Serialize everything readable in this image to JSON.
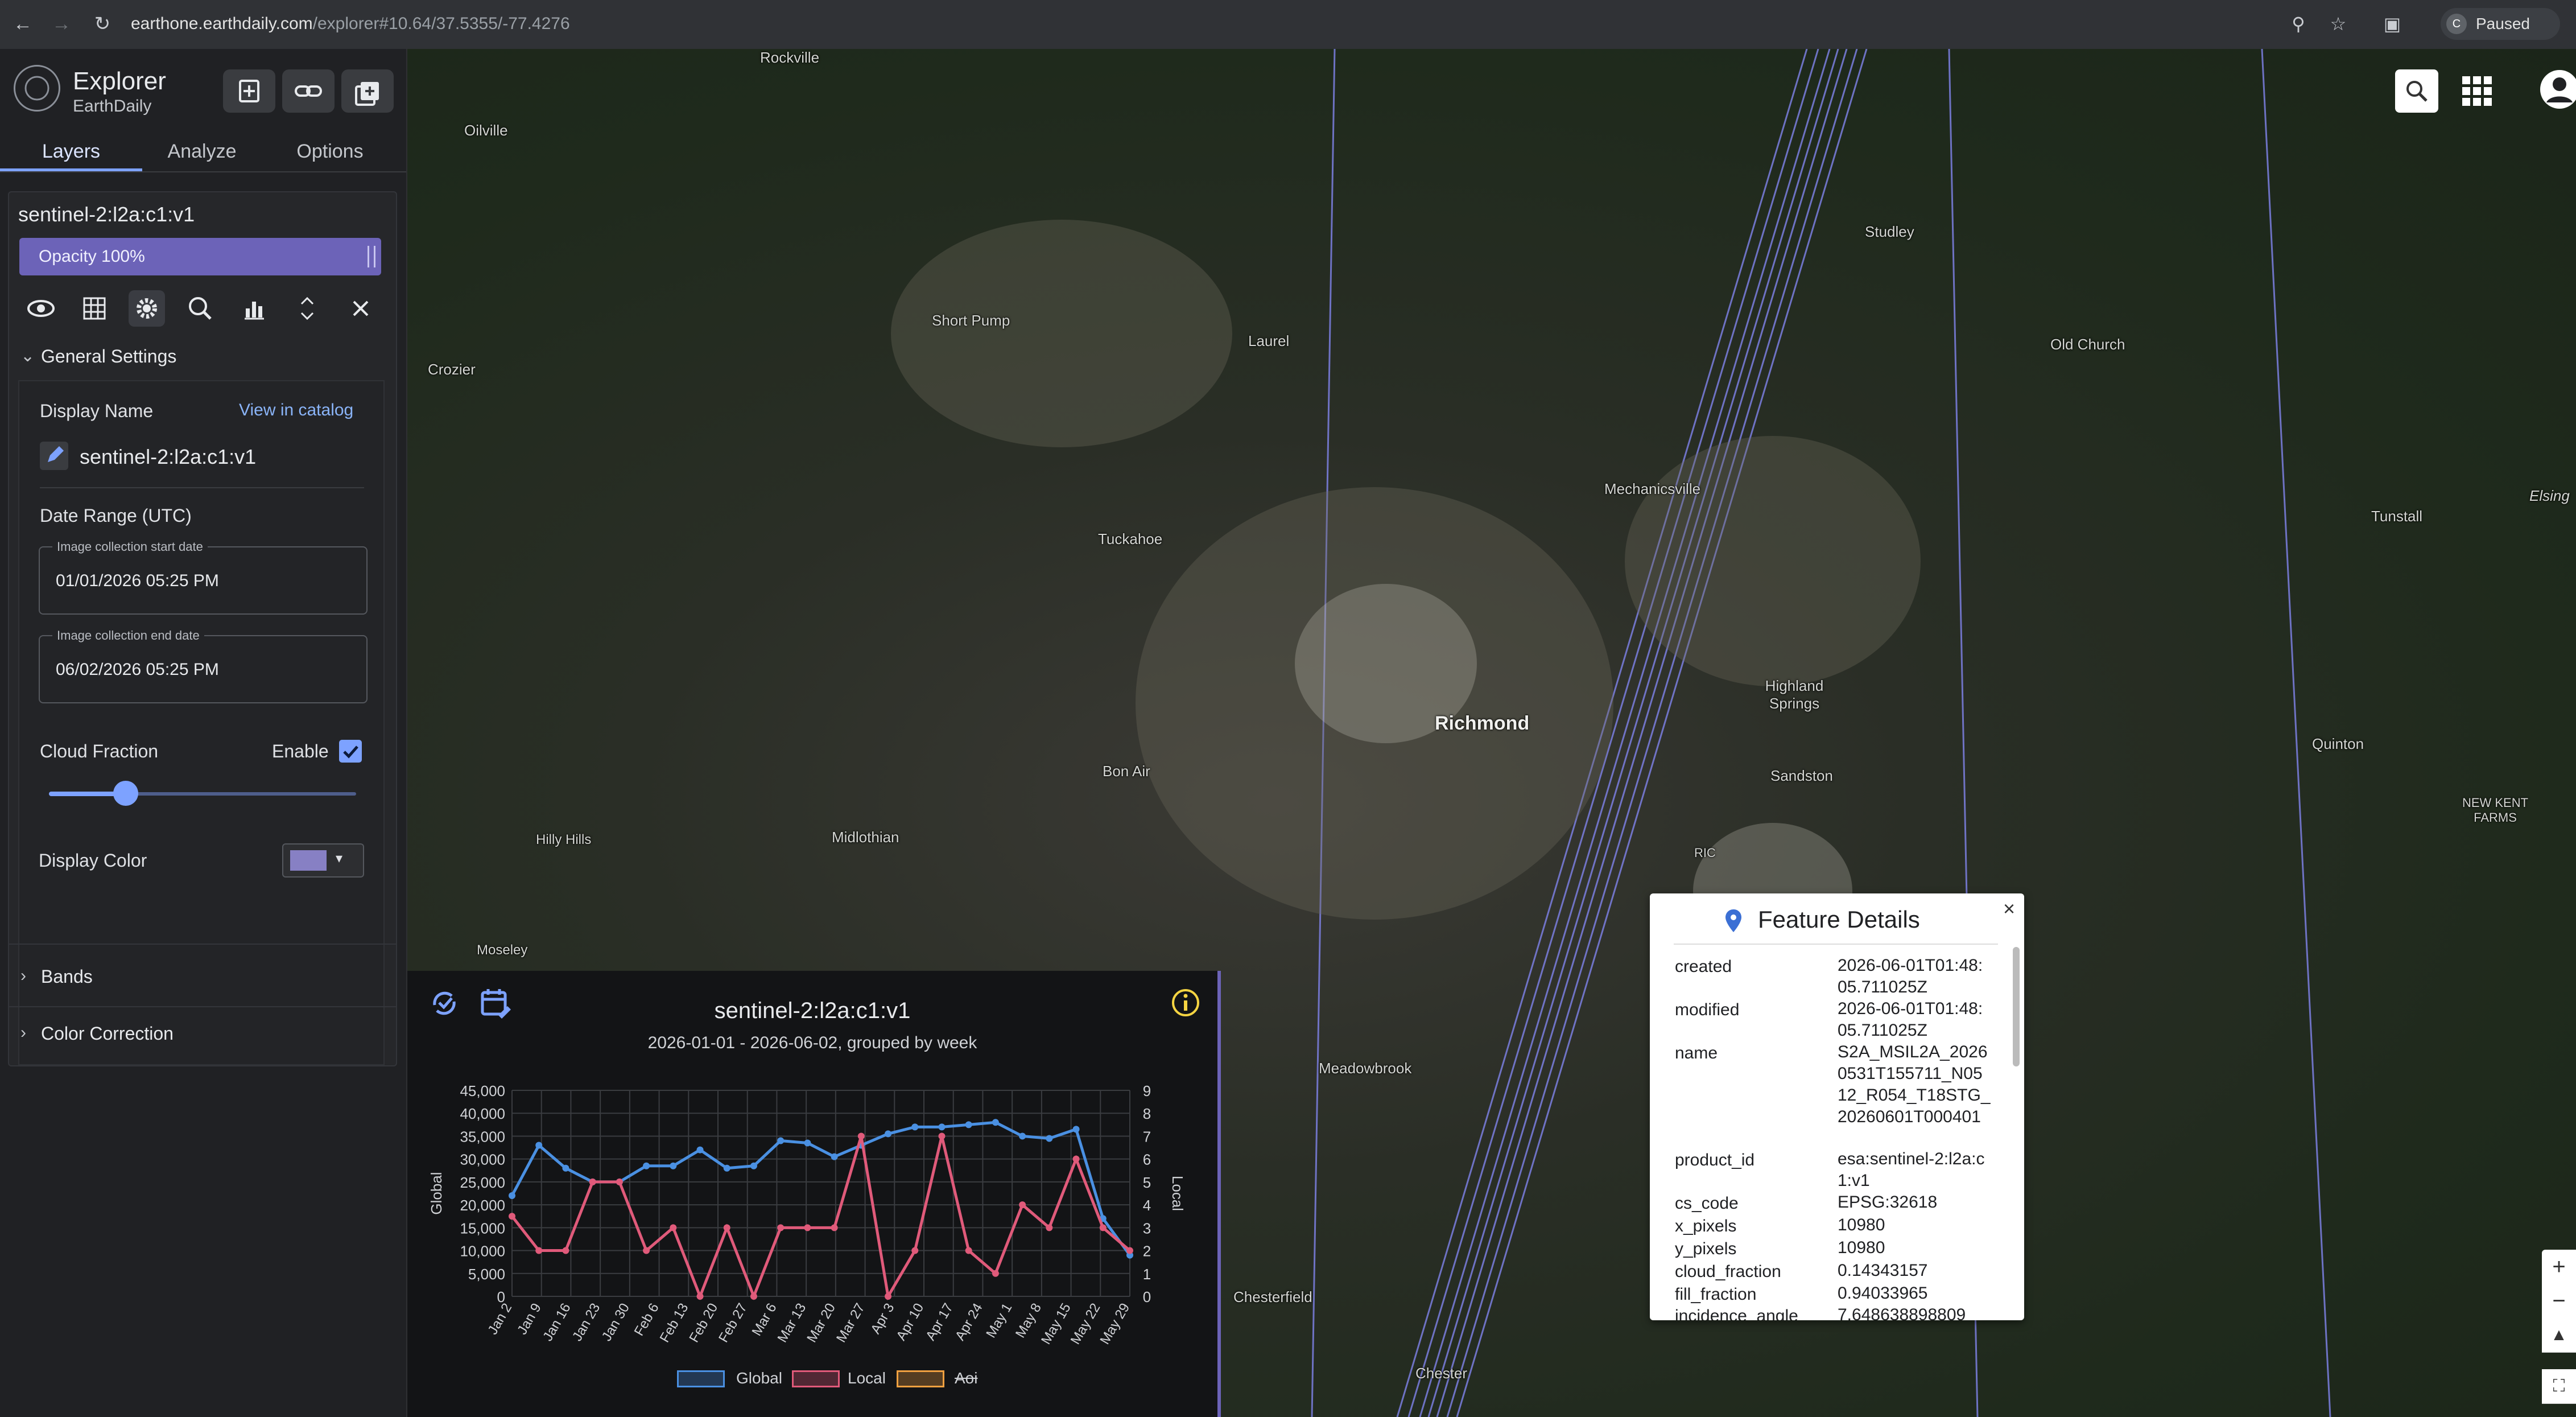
{
  "browser": {
    "url_host": "earthone.earthdaily.com",
    "url_path": "/explorer#10.64/37.5355/-77.4276",
    "profile_initial": "C",
    "profile_status": "Paused"
  },
  "app": {
    "title": "Explorer",
    "subtitle": "EarthDaily",
    "tabs": [
      "Layers",
      "Analyze",
      "Options"
    ],
    "active_tab": "Layers"
  },
  "layer": {
    "name": "sentinel-2:l2a:c1:v1",
    "opacity_label": "Opacity 100%",
    "opacity": 1.0,
    "general_settings_label": "General Settings",
    "display_name_label": "Display Name",
    "view_in_catalog": "View in catalog",
    "display_name_value": "sentinel-2:l2a:c1:v1",
    "date_range_label": "Date Range (UTC)",
    "start_caption": "Image collection start date",
    "start_value": "01/01/2026 05:25 PM",
    "end_caption": "Image collection end date",
    "end_value": "06/02/2026 05:25 PM",
    "cloud_fraction_label": "Cloud Fraction",
    "enable_label": "Enable",
    "cloud_fraction_value": 0.25,
    "display_color_label": "Display Color",
    "display_color": "#8780c4",
    "bands_label": "Bands",
    "color_correction_label": "Color Correction"
  },
  "map": {
    "places": [
      "Rockville",
      "Oilville",
      "Short Pump",
      "Laurel",
      "Studley",
      "Old Church",
      "Crozier",
      "Mechanicsville",
      "Tuckahoe",
      "Elsing",
      "Tunstall",
      "Highland Springs",
      "Richmond",
      "Sandston",
      "Bon Air",
      "Quinton",
      "NEW KENT FARMS",
      "Midlothian",
      "RIC",
      "Hilly Hills",
      "Moseley",
      "Meadowbrook",
      "Chesterfield",
      "Chester"
    ],
    "zoom_in": "+",
    "zoom_out": "−"
  },
  "feature_details": {
    "title": "Feature Details",
    "rows": [
      {
        "key": "created",
        "value": "2026-06-01T01:48:05.711025Z"
      },
      {
        "key": "modified",
        "value": "2026-06-01T01:48:05.711025Z"
      },
      {
        "key": "name",
        "value": "S2A_MSIL2A_20260531T155711_N0512_R054_T18STG_20260601T000401"
      },
      {
        "key": "product_id",
        "value": "esa:sentinel-2:l2a:c1:v1"
      },
      {
        "key": "cs_code",
        "value": "EPSG:32618"
      },
      {
        "key": "x_pixels",
        "value": "10980"
      },
      {
        "key": "y_pixels",
        "value": "10980"
      },
      {
        "key": "cloud_fraction",
        "value": "0.14343157"
      },
      {
        "key": "fill_fraction",
        "value": "0.94033965"
      },
      {
        "key": "incidence_angle",
        "value": "7.648638898809"
      }
    ]
  },
  "chart_data": {
    "type": "line",
    "title": "sentinel-2:l2a:c1:v1",
    "subtitle": "2026-01-01 - 2026-06-02, grouped by week",
    "ylabel": "Global",
    "y2label": "Local",
    "ylim": [
      0,
      45000
    ],
    "y2lim": [
      0,
      9
    ],
    "yticks": [
      "0",
      "5,000",
      "10,000",
      "15,000",
      "20,000",
      "25,000",
      "30,000",
      "35,000",
      "40,000",
      "45,000"
    ],
    "y2ticks": [
      "0",
      "1",
      "2",
      "3",
      "4",
      "5",
      "6",
      "7",
      "8",
      "9"
    ],
    "categories": [
      "Jan 2",
      "Jan 9",
      "Jan 16",
      "Jan 23",
      "Jan 30",
      "Feb 6",
      "Feb 13",
      "Feb 20",
      "Feb 27",
      "Mar 6",
      "Mar 13",
      "Mar 20",
      "Mar 27",
      "Apr 3",
      "Apr 10",
      "Apr 17",
      "Apr 24",
      "May 1",
      "May 8",
      "May 15",
      "May 22",
      "May 29"
    ],
    "x": [
      0,
      0.5,
      1,
      1.5,
      2,
      2.5,
      3,
      3.5,
      4,
      4.5,
      5,
      5.5,
      6,
      6.5,
      7,
      7.5,
      8,
      8.5,
      9,
      9.5,
      10,
      10.5,
      11,
      11.5,
      12,
      12.5,
      13,
      13.5,
      14,
      14.5,
      15,
      15.5,
      16,
      16.5,
      17,
      17.5,
      18,
      18.5,
      19,
      19.5,
      20,
      20.5,
      21,
      21.5
    ],
    "series": [
      {
        "name": "Global",
        "color": "#4a90e2",
        "axis": "left",
        "values": [
          22000,
          33000,
          28000,
          25000,
          25000,
          28500,
          28500,
          32000,
          28000,
          28500,
          34000,
          33500,
          30500,
          33000,
          35500,
          37000,
          37000,
          37500,
          38000,
          35000,
          34500,
          36500,
          17000,
          9000
        ]
      },
      {
        "name": "Local",
        "color": "#e05a7a",
        "axis": "right",
        "values": [
          3.5,
          2,
          2,
          5,
          5,
          2,
          3,
          0,
          3,
          0,
          3,
          3,
          3,
          7,
          0,
          2,
          7,
          2,
          1,
          4,
          3,
          6,
          3,
          2
        ]
      },
      {
        "name": "Aoi",
        "color": "#f0a040",
        "axis": "right",
        "values": [],
        "hidden": true
      }
    ],
    "legend": [
      "Global",
      "Local",
      "Aoi"
    ]
  }
}
